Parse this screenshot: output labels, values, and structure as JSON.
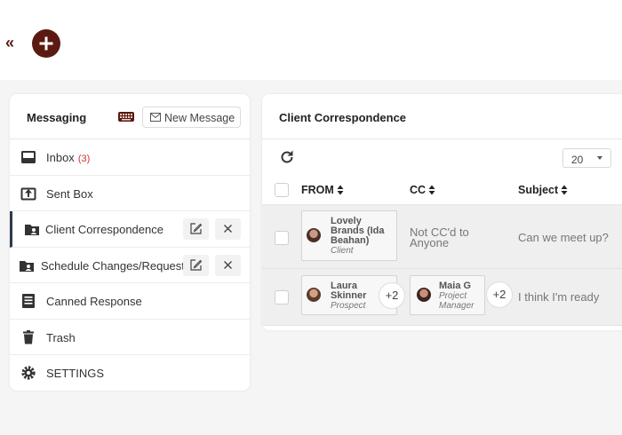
{
  "topbar": {
    "collapse_glyph": "«",
    "add_button_icon": "plus-icon",
    "brand_color": "#5a1a12"
  },
  "sidebar": {
    "title": "Messaging",
    "keyboard_icon": "keyboard-icon",
    "new_message_label": "New Message",
    "items": [
      {
        "label": "Inbox",
        "badge": "(3)",
        "icon": "inbox-icon"
      },
      {
        "label": "Sent Box",
        "icon": "sent-box-icon"
      },
      {
        "label": "Client Correspondence",
        "icon": "folder-user-icon",
        "active": true
      },
      {
        "label": "Schedule Changes/Requests",
        "icon": "folder-user-icon"
      },
      {
        "label": "Canned Response",
        "icon": "canned-response-icon"
      },
      {
        "label": "Trash",
        "icon": "trash-icon"
      },
      {
        "label": "SETTINGS",
        "icon": "gear-icon"
      }
    ]
  },
  "main": {
    "title": "Client Correspondence",
    "page_size": "20",
    "columns": [
      "FROM",
      "CC",
      "Subject"
    ],
    "rows": [
      {
        "from": {
          "name": "Lovely Brands (Ida Beahan)",
          "role": "Client"
        },
        "cc_text": "Not CC'd to Anyone",
        "subject": "Can we meet up?"
      },
      {
        "from": {
          "name": "Laura Skinner",
          "role": "Prospect",
          "extra": "+2"
        },
        "cc": {
          "name": "Maia G",
          "role": "Project Manager",
          "extra": "+2"
        },
        "subject": "I think I'm ready"
      }
    ]
  }
}
